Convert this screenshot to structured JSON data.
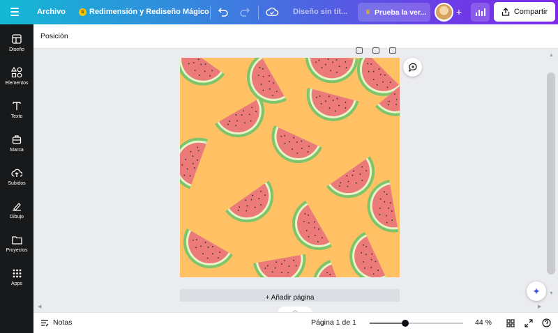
{
  "topbar": {
    "menu_icon": "hamburger-menu-icon",
    "file_label": "Archivo",
    "resize_label": "Redimensión y Rediseño Mágico",
    "doc_name": "Diseño sin tít...",
    "try_label": "Prueba la ver...",
    "add_label": "+",
    "share_label": "Compartir",
    "gradient": [
      "#13b9d4",
      "#3d7be0",
      "#7d2ae8"
    ]
  },
  "sidebar": {
    "items": [
      {
        "label": "Diseño",
        "icon": "layout-icon"
      },
      {
        "label": "Elementos",
        "icon": "shapes-icon"
      },
      {
        "label": "Texto",
        "icon": "text-icon"
      },
      {
        "label": "Marca",
        "icon": "brand-icon"
      },
      {
        "label": "Subidos",
        "icon": "upload-icon"
      },
      {
        "label": "Dibujo",
        "icon": "draw-icon"
      },
      {
        "label": "Proyectos",
        "icon": "folder-icon"
      },
      {
        "label": "Apps",
        "icon": "apps-grid-icon"
      }
    ]
  },
  "editor": {
    "position_label": "Posición",
    "add_page_label": "+ Añadir página",
    "canvas_background": "#ffc163"
  },
  "bottombar": {
    "notes_label": "Notas",
    "page_count": "Página 1 de 1",
    "zoom_value": "44 %",
    "zoom_fraction": 0.38
  }
}
